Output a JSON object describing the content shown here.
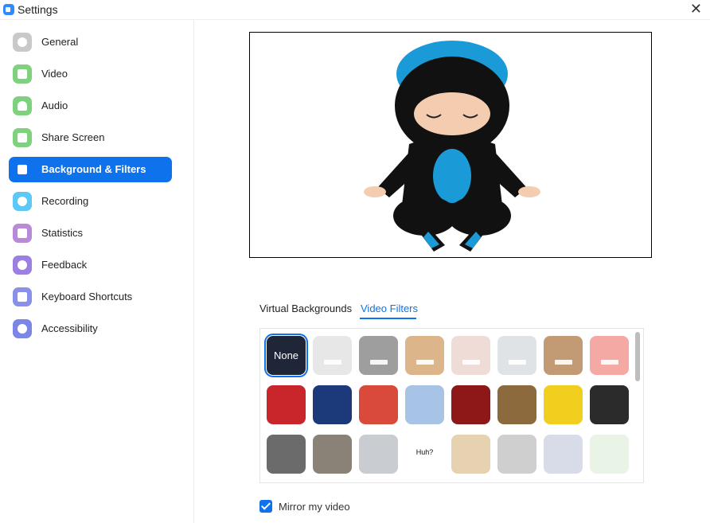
{
  "window": {
    "title": "Settings",
    "close_glyph": "✕"
  },
  "sidebar": {
    "items": [
      {
        "label": "General",
        "icon": "gear-icon",
        "color": "#c9c9c9"
      },
      {
        "label": "Video",
        "icon": "video-camera-icon",
        "color": "#7ed27e"
      },
      {
        "label": "Audio",
        "icon": "headphones-icon",
        "color": "#7ed27e"
      },
      {
        "label": "Share Screen",
        "icon": "share-screen-icon",
        "color": "#7ed27e"
      },
      {
        "label": "Background & Filters",
        "icon": "background-icon",
        "color": "#0e72ed",
        "active": true
      },
      {
        "label": "Recording",
        "icon": "record-icon",
        "color": "#5bc8f5"
      },
      {
        "label": "Statistics",
        "icon": "bar-chart-icon",
        "color": "#b98ad8"
      },
      {
        "label": "Feedback",
        "icon": "smiley-icon",
        "color": "#9c7fe0"
      },
      {
        "label": "Keyboard Shortcuts",
        "icon": "keyboard-icon",
        "color": "#8a8fe8"
      },
      {
        "label": "Accessibility",
        "icon": "accessibility-icon",
        "color": "#7c86e6"
      }
    ]
  },
  "tabs": [
    {
      "label": "Virtual Backgrounds",
      "active": false
    },
    {
      "label": "Video Filters",
      "active": true
    }
  ],
  "filters": {
    "rows": [
      [
        {
          "name": "None",
          "label": "None",
          "color": "#1f2638",
          "selected": true
        },
        {
          "name": "studio-light",
          "color": "#e7e7e7"
        },
        {
          "name": "studio-gray",
          "color": "#9e9e9e"
        },
        {
          "name": "studio-tan",
          "color": "#dcb68a"
        },
        {
          "name": "studio-blush",
          "color": "#f0dcd6"
        },
        {
          "name": "studio-cool",
          "color": "#dfe3e6"
        },
        {
          "name": "studio-brown",
          "color": "#c29a74"
        },
        {
          "name": "studio-pink",
          "color": "#f5a9a4"
        }
      ],
      [
        {
          "name": "video-frame-red",
          "color": "#c9262c"
        },
        {
          "name": "string-lights",
          "color": "#1c3a7a"
        },
        {
          "name": "holiday-wreath",
          "color": "#d94a3a"
        },
        {
          "name": "snow-house",
          "color": "#a7c4e6"
        },
        {
          "name": "theater-curtain",
          "color": "#8e1717"
        },
        {
          "name": "retro-tv",
          "color": "#8d6a3e"
        },
        {
          "name": "emoji-frame",
          "color": "#f2cf1f"
        },
        {
          "name": "marquee-lights",
          "color": "#2b2b2b"
        }
      ],
      [
        {
          "name": "focus-frame",
          "color": "#6b6b6b"
        },
        {
          "name": "old-tv",
          "color": "#8a8276"
        },
        {
          "name": "award-ribbon",
          "color": "#c9ccd1"
        },
        {
          "name": "speech-bubble",
          "label": "Huh?",
          "color": "#ffffff"
        },
        {
          "name": "wall-mirror",
          "color": "#e6d2b0"
        },
        {
          "name": "picture-frame",
          "color": "#cfcfcf"
        },
        {
          "name": "cockatiel",
          "color": "#d7dce8"
        },
        {
          "name": "leaf-pastel",
          "color": "#e9f3e6"
        }
      ]
    ]
  },
  "mirror": {
    "label": "Mirror my video",
    "checked": true
  },
  "colors": {
    "accent": "#0e72ed"
  }
}
